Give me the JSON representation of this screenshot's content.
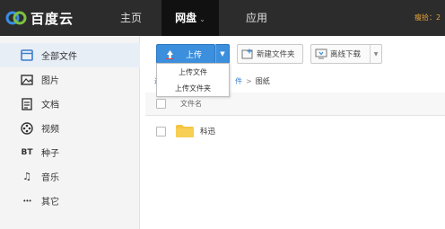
{
  "brand": {
    "name": "百度云"
  },
  "nav": {
    "items": [
      {
        "label": "主页"
      },
      {
        "label": "网盘"
      },
      {
        "label": "应用"
      }
    ],
    "user_label": "瘦拾：2"
  },
  "sidebar": {
    "items": [
      {
        "label": "全部文件",
        "icon": "folder-icon"
      },
      {
        "label": "图片",
        "icon": "image-icon"
      },
      {
        "label": "文档",
        "icon": "document-icon"
      },
      {
        "label": "视频",
        "icon": "video-icon"
      },
      {
        "label": "种子",
        "icon": "bt-icon",
        "icon_text": "BT"
      },
      {
        "label": "音乐",
        "icon": "music-icon"
      },
      {
        "label": "其它",
        "icon": "more-icon",
        "icon_text": "•••"
      }
    ]
  },
  "toolbar": {
    "upload_label": "上传",
    "new_folder_label": "新建文件夹",
    "offline_label": "离线下载"
  },
  "upload_menu": {
    "items": [
      {
        "label": "上传文件"
      },
      {
        "label": "上传文件夹"
      }
    ]
  },
  "breadcrumb": {
    "back": "返",
    "segment": "件",
    "separator": ">",
    "current": "图纸"
  },
  "file_list": {
    "header_name": "文件名",
    "rows": [
      {
        "name": "科迅",
        "type": "folder"
      }
    ]
  },
  "colors": {
    "topbar": "#2c2c2c",
    "primary_button": "#3b8fdd",
    "sidebar_bg": "#f4f4f4",
    "link": "#3b7fcc",
    "folder": "#f5c542"
  }
}
